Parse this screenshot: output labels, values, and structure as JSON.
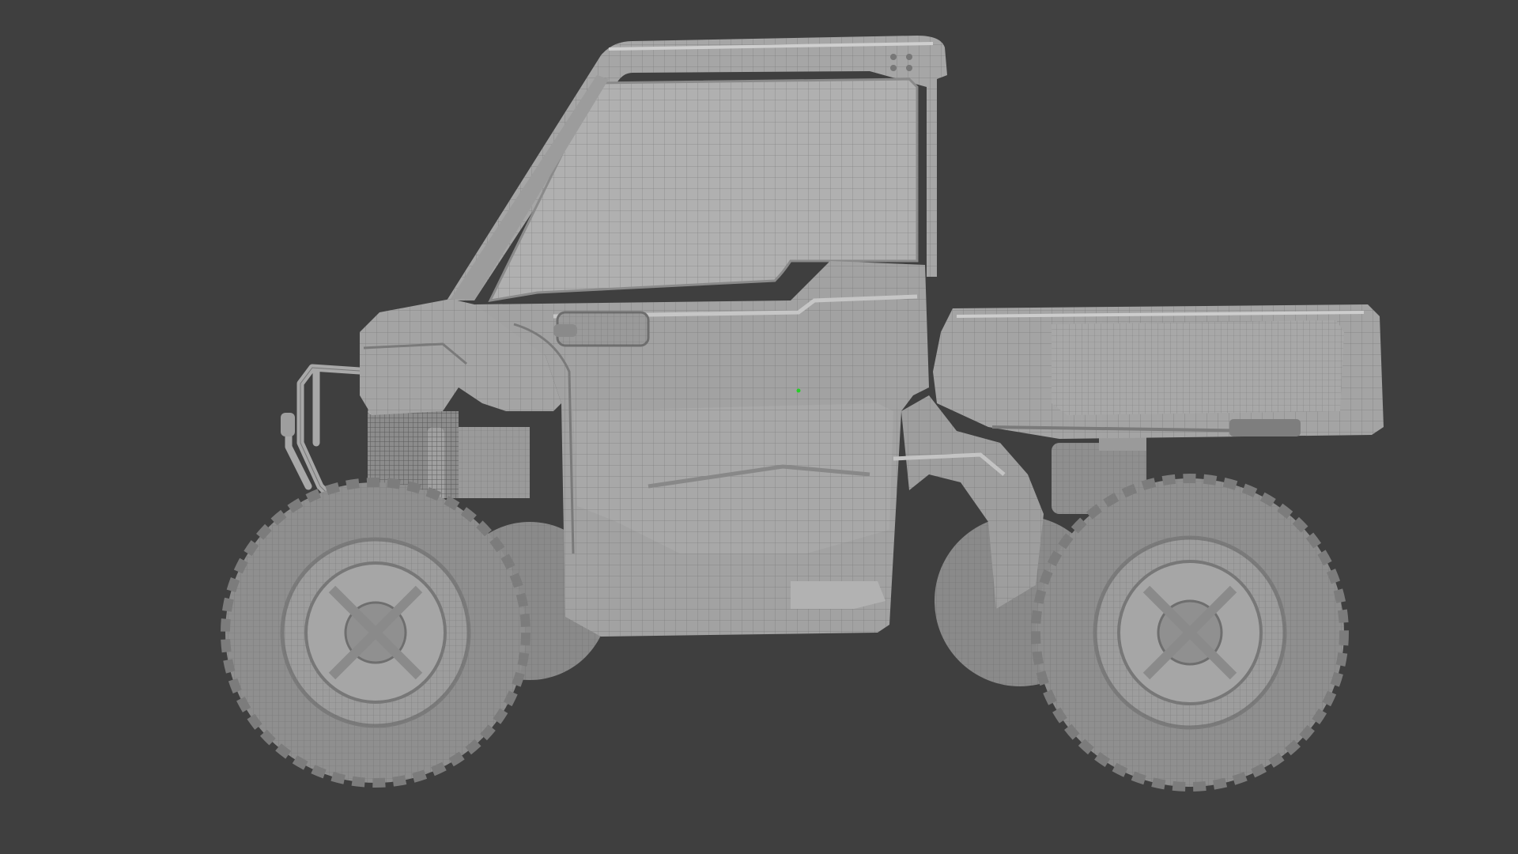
{
  "scene": {
    "subject": "utv-side-by-side-wireframe-render",
    "view": "side",
    "shading": "wireframe-on-clay"
  },
  "colors": {
    "background": "#3f3f3f",
    "clay": "#9c9c9c",
    "clay_light": "#b4b4b4",
    "clay_dark": "#7e7e7e",
    "wire": "#5e5e5e",
    "tire": "#8e8e8e",
    "marker": "#26d026"
  }
}
